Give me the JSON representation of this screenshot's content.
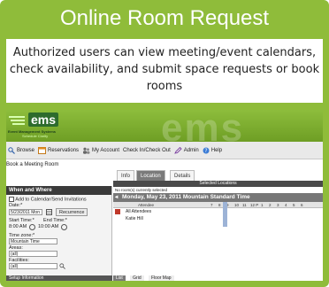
{
  "slide": {
    "title": "Online Room Request",
    "caption": "Authorized users can view meeting/event calendars, check availability, and submit space requests or book rooms"
  },
  "app": {
    "logo": {
      "text": "ems",
      "subtitle": "Event Management Systems",
      "tagline": "Schedule Clarity"
    },
    "watermark": "ems",
    "toolbar": [
      "Browse",
      "Reservations",
      "My Account",
      "Check In/Check Out",
      "Admin",
      "Help"
    ],
    "page_heading": "Book a Meeting Room",
    "tabs": [
      "Info",
      "Location",
      "Details"
    ],
    "active_tab": "Location",
    "when_where": {
      "heading": "When and Where",
      "calendar_checkbox": "Add to Calendar/Send Invitations",
      "date_label": "Date:*",
      "date_value": "5/23/2011 Mon",
      "recurrence_button": "Recurrence",
      "start_label": "Start Time:*",
      "end_label": "End Time:*",
      "start_value": "8:00 AM",
      "end_value": "10:00 AM",
      "timezone_label": "Time zone:*",
      "timezone_value": "Mountain Time",
      "areas_label": "Areas:",
      "areas_value": "(all)",
      "facilities_label": "Facilities:",
      "facilities_value": "(all)",
      "footer": "Setup Information"
    },
    "selected_locations": {
      "heading": "Selected Locations",
      "empty_text": "No room(s) currently selected",
      "day_heading": "Monday, May 23, 2011 Mountain Standard Time",
      "attendee_header": "Attendee",
      "hours": [
        "7",
        "8",
        "9",
        "10",
        "11",
        "12 P",
        "1",
        "2",
        "3",
        "4",
        "5",
        "6"
      ],
      "attendees": [
        "All Attendees",
        "Katie Hill"
      ]
    },
    "bottom_tabs": [
      "List",
      "Grid",
      "Floor Map"
    ],
    "accent_color": "#8fbc3a"
  }
}
